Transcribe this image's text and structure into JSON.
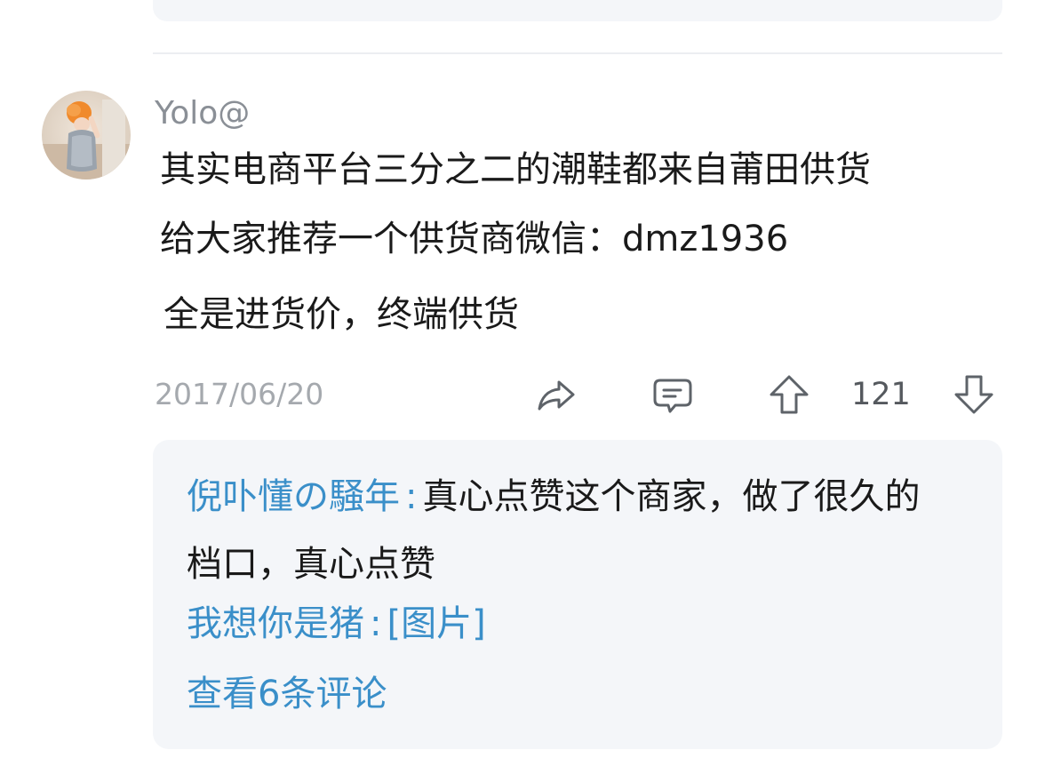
{
  "comment": {
    "username": "Yolo@",
    "content_lines": [
      "其实电商平台三分之二的潮鞋都来自莆田供货",
      "给大家推荐一个供货商微信：dmz1936",
      "全是进货价，终端供货"
    ],
    "date": "2017/06/20",
    "vote_count": "121",
    "icons": {
      "share": "share-icon",
      "comment": "comment-icon",
      "upvote": "upvote-icon",
      "downvote": "downvote-icon"
    }
  },
  "replies": [
    {
      "user": "倪卟懂の騒年",
      "separator": ":",
      "text_line1": "真心点赞这个商家，做了很久的",
      "text_line2": "档口，真心点赞"
    },
    {
      "user": "我想你是猪",
      "separator": ":",
      "text": "[图片]"
    }
  ],
  "view_more_label": "查看6条评论",
  "colors": {
    "accent": "#3a8fc9",
    "reply_bg": "#f4f6f9",
    "username": "#8a8f96",
    "date": "#a5a9ae",
    "text": "#1a1a1a"
  }
}
